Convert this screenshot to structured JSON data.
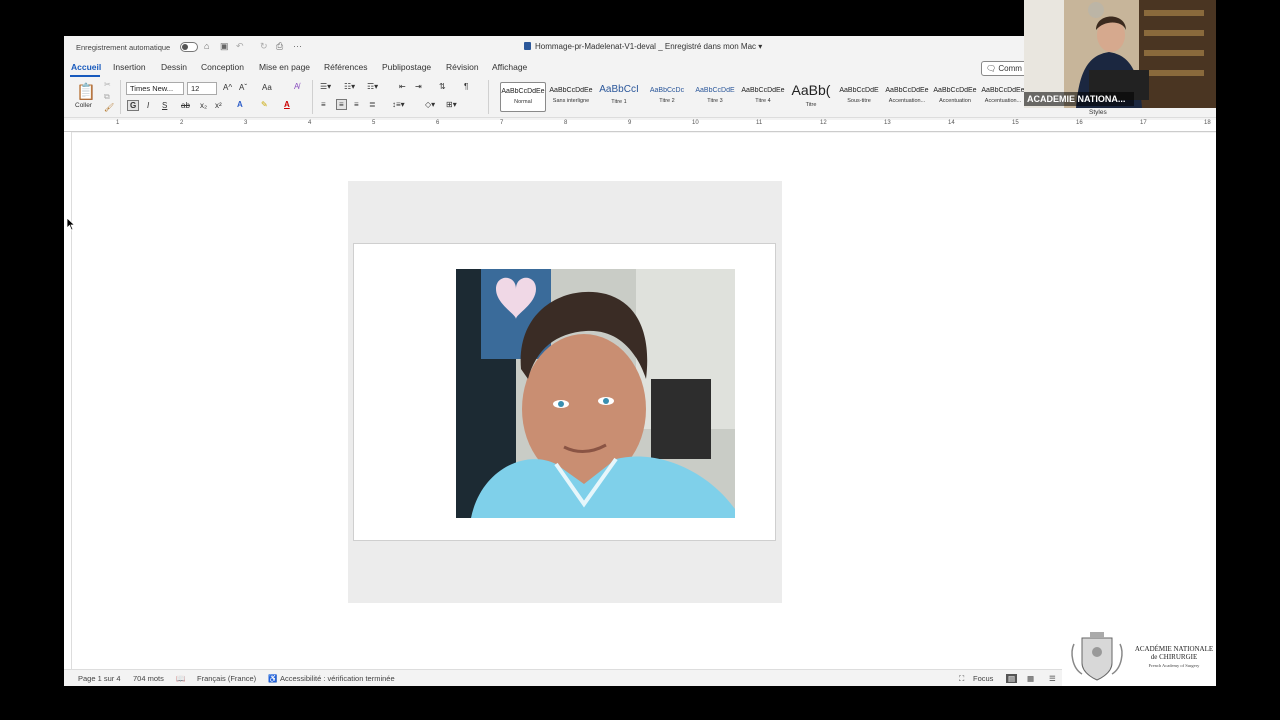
{
  "titlebar": {
    "autosave_label": "Enregistrement automatique",
    "document_title": "Hommage-pr-Madelenat-V1-deval",
    "save_status": "Enregistré dans mon Mac"
  },
  "tabs": [
    {
      "label": "Accueil",
      "active": true
    },
    {
      "label": "Insertion"
    },
    {
      "label": "Dessin"
    },
    {
      "label": "Conception"
    },
    {
      "label": "Mise en page"
    },
    {
      "label": "Références"
    },
    {
      "label": "Publipostage"
    },
    {
      "label": "Révision"
    },
    {
      "label": "Affichage"
    }
  ],
  "comment_button": "Comm",
  "ribbon": {
    "paste_label": "Coller",
    "font_name": "Times New...",
    "font_size": "12",
    "case_label": "Aa",
    "bold": "G",
    "italic": "I",
    "underline": "S",
    "strike": "ab",
    "subscript": "x₂",
    "superscript": "x²",
    "grow": "A^",
    "shrink": "Aˇ",
    "styles_label": "Styles"
  },
  "styles": [
    {
      "sample": "AaBbCcDdEe",
      "name": "Normal",
      "selected": true
    },
    {
      "sample": "AaBbCcDdEe",
      "name": "Sans interligne"
    },
    {
      "sample": "AaBbCcI",
      "name": "Titre 1"
    },
    {
      "sample": "AaBbCcDc",
      "name": "Titre 2"
    },
    {
      "sample": "AaBbCcDdE",
      "name": "Titre 3"
    },
    {
      "sample": "AaBbCcDdEe",
      "name": "Titre 4"
    },
    {
      "sample": "AaBb(",
      "name": "Titre"
    },
    {
      "sample": "AaBbCcDdE",
      "name": "Sous-titre"
    },
    {
      "sample": "AaBbCcDdEe",
      "name": "Accentuation..."
    },
    {
      "sample": "AaBbCcDdEe",
      "name": "Accentuation"
    },
    {
      "sample": "AaBbCcDdEe",
      "name": "Accentuation..."
    }
  ],
  "ruler_numbers": [
    "1",
    "2",
    "3",
    "4",
    "5",
    "6",
    "7",
    "8",
    "9",
    "10",
    "11",
    "12",
    "13",
    "14",
    "15",
    "16",
    "17",
    "18"
  ],
  "statusbar": {
    "page": "Page 1 sur 4",
    "words": "704 mots",
    "language": "Français (France)",
    "accessibility": "Accessibilité : vérification terminée",
    "focus": "Focus"
  },
  "webcam": {
    "label": "ACADEMIE NATIONA..."
  },
  "logo": {
    "line1": "ACADÉMIE NATIONALE",
    "line2": "de CHIRURGIE",
    "line3": "French Academy of Surgery"
  },
  "colors": {
    "accent": "#185abd",
    "photo_shirt": "#7fd0ea"
  }
}
